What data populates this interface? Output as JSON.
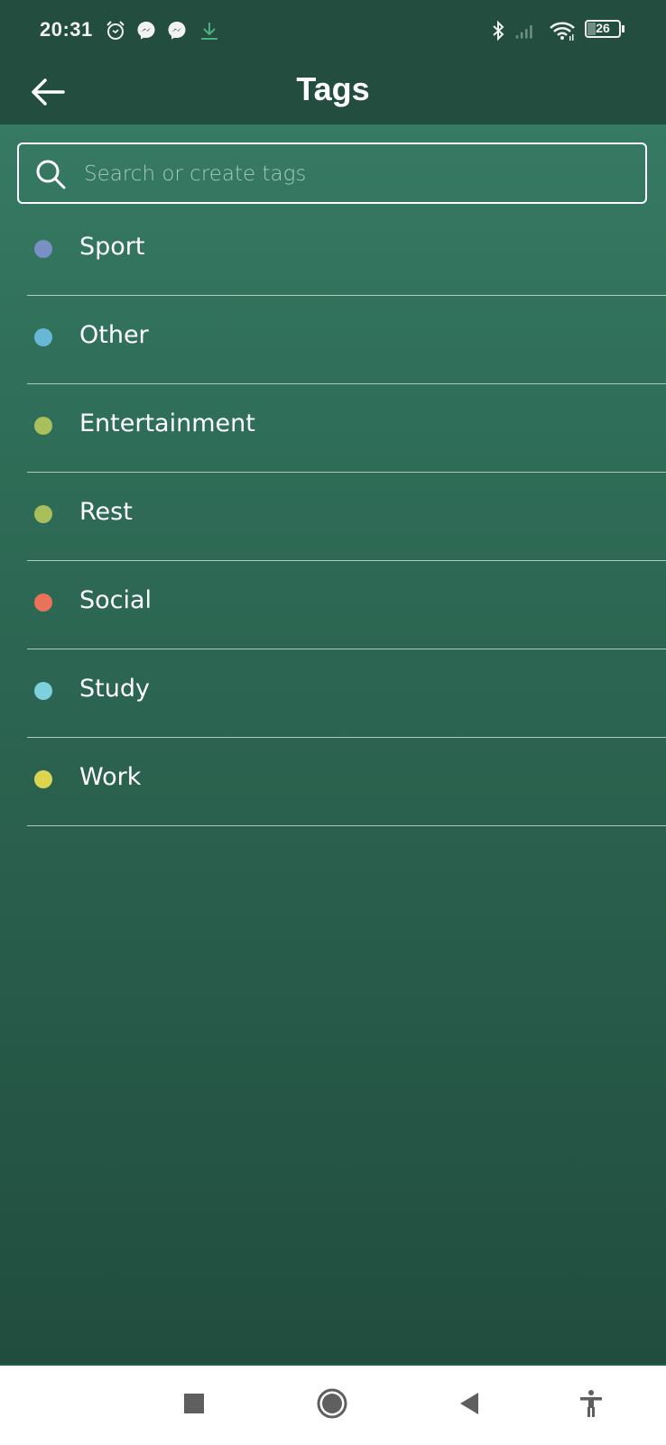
{
  "status_bar": {
    "time": "20:31",
    "left_icons": [
      "alarm-icon",
      "messenger-icon",
      "messenger-icon",
      "download-icon"
    ],
    "right_icons": [
      "bluetooth-icon",
      "signal-icon",
      "wifi-icon",
      "battery-icon"
    ],
    "battery_level": "26",
    "download_icon_color": "#4caf7d"
  },
  "header": {
    "title": "Tags",
    "back_icon": "arrow-left-icon"
  },
  "search": {
    "placeholder": "Search or create tags",
    "value": "",
    "icon": "search-icon"
  },
  "tags": [
    {
      "label": "Sport",
      "color": "#7a8fc4"
    },
    {
      "label": "Other",
      "color": "#66b8d6"
    },
    {
      "label": "Entertainment",
      "color": "#a9bf5c"
    },
    {
      "label": "Rest",
      "color": "#a9bf5c"
    },
    {
      "label": "Social",
      "color": "#e8735a"
    },
    {
      "label": "Study",
      "color": "#7fd0de"
    },
    {
      "label": "Work",
      "color": "#d9d654"
    }
  ],
  "nav_bar": {
    "buttons": [
      "recents-icon",
      "home-icon",
      "back-icon",
      "accessibility-icon"
    ]
  },
  "colors": {
    "top_bar": "#234d3f",
    "content_top": "#3a7f68",
    "content_bottom": "#214d3e",
    "nav_icon": "#666666"
  }
}
